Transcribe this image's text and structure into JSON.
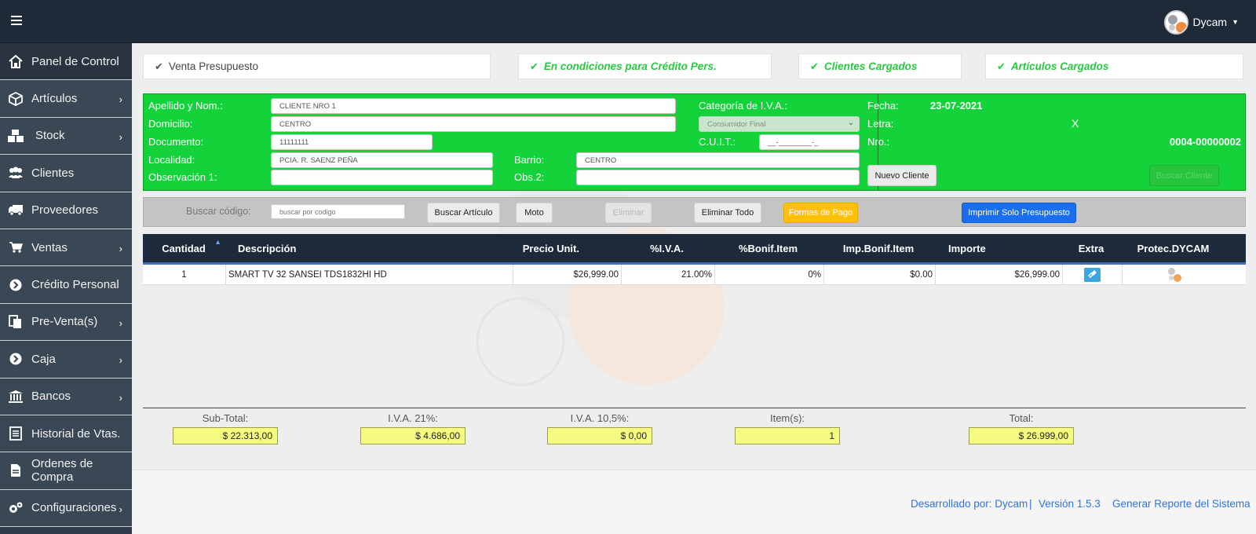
{
  "app": {
    "user_name": "Dycam"
  },
  "sidebar": {
    "items": [
      {
        "label": "Panel de Control",
        "icon": "home-icon"
      },
      {
        "label": "Artículos",
        "icon": "cube-icon"
      },
      {
        "label": "Stock",
        "icon": "cubes-icon"
      },
      {
        "label": "Clientes",
        "icon": "users-icon"
      },
      {
        "label": "Proveedores",
        "icon": "truck-icon"
      },
      {
        "label": "Ventas",
        "icon": "cart-icon"
      },
      {
        "label": "Crédito Personal",
        "icon": "circle-arrow-icon"
      },
      {
        "label": "Pre-Venta(s)",
        "icon": "copy-icon"
      },
      {
        "label": "Caja",
        "icon": "circle-arrow-icon"
      },
      {
        "label": "Bancos",
        "icon": "bank-icon"
      },
      {
        "label": "Historial de Vtas.",
        "icon": "list-icon"
      },
      {
        "label": "Ordenes de Compra",
        "icon": "file-icon"
      },
      {
        "label": "Configuraciones",
        "icon": "gears-icon"
      }
    ]
  },
  "status": {
    "venta": "Venta Presupuesto",
    "credito": "En condiciones para Crédito Pers.",
    "clientes": "Clientes Cargados",
    "articulos": "Artículos Cargados"
  },
  "client": {
    "labels": {
      "apellido": "Apellido y Nom.:",
      "domicilio": "Domicilio:",
      "documento": "Documento:",
      "localidad": "Localidad:",
      "observacion": "Observación 1:",
      "categoria": "Categoría de I.V.A.:",
      "cuit": "C.U.I.T.:",
      "barrio": "Barrio:",
      "obs2": "Obs.2:",
      "fecha": "Fecha:",
      "letra": "Letra:",
      "nro": "Nro.:"
    },
    "apellido": "CLIENTE NRO 1",
    "domicilio": "CENTRO",
    "documento": "11111111",
    "localidad": "PCIA. R. SAENZ PEÑA",
    "observacion": "",
    "categoria": "Consumidor Final",
    "cuit": "__-________-_",
    "barrio": "CENTRO",
    "obs2": "",
    "fecha": "23-07-2021",
    "letra": "X",
    "nro": "0004-00000002",
    "nuevo_cliente": "Nuevo Cliente",
    "buscar_cliente": "Buscar Cliente"
  },
  "toolbar": {
    "buscar_label": "Buscar código:",
    "buscar_placeholder": "buscar por codigo",
    "buscar_articulo": "Buscar Artículo",
    "moto": "Moto",
    "eliminar": "Eliminar",
    "eliminar_todo": "Eliminar Todo",
    "formas_pago": "Formas de Pago",
    "imprimir": "Imprimir Solo Presupuesto"
  },
  "table": {
    "headers": [
      "Cantidad",
      "Descripción",
      "Precio Unit.",
      "%I.V.A.",
      "%Bonif.Item",
      "Imp.Bonif.Item",
      "Importe",
      "Extra",
      "Protec.DYCAM"
    ],
    "sort_indicator": "▲",
    "rows": [
      {
        "cantidad": "1",
        "descripcion": "SMART TV 32 SANSEI TDS1832HI HD",
        "precio": "$26,999.00",
        "iva": "21.00%",
        "bonif": "0%",
        "imp_bonif": "$0.00",
        "importe": "$26,999.00"
      }
    ]
  },
  "totals": {
    "subtotal_label": "Sub-Total:",
    "subtotal": "$ 22.313,00",
    "iva21_label": "I.V.A. 21%:",
    "iva21": "$ 4.686,00",
    "iva105_label": "I.V.A. 10,5%:",
    "iva105": "$ 0,00",
    "items_label": "Item(s):",
    "items": "1",
    "total_label": "Total:",
    "total": "$ 26.999,00"
  },
  "footer": {
    "dev": "Desarrollado por: Dycam",
    "sep": "|",
    "version": "Versión 1.5.3",
    "reporte": "Generar Reporte del Sistema"
  },
  "colors": {
    "topbar": "#1f2a38",
    "sidebar": "#3a4754",
    "client_green": "#14d23a",
    "formas_pago": "#ffc107",
    "imprimir": "#1a6ff0",
    "link": "#2f75d8"
  }
}
